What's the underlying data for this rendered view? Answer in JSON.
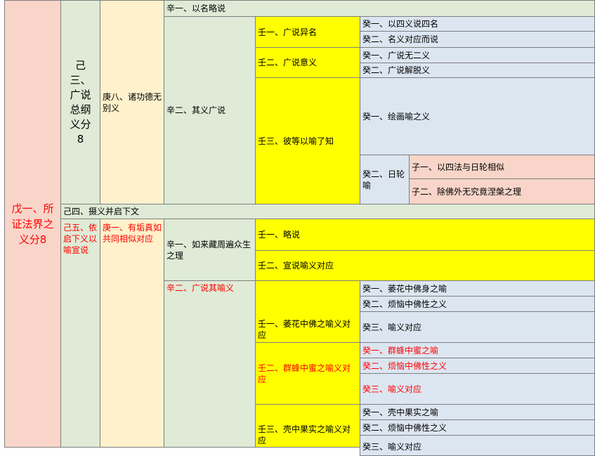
{
  "wu1": "戊一、所证法界之义分8",
  "ji3": "己三、广说总纲义分8",
  "geng8": "庚八、诸功德无别义",
  "xin1": "辛一、以名略说",
  "xin2_top": "辛二、其义广说",
  "ren1": "壬一、广说异名",
  "ren2": "壬二、广说意义",
  "ren3": "壬三、彼等以喻了知",
  "gui_r1_1": "癸一、以四义说四名",
  "gui_r1_2": "癸二、名义对应而说",
  "gui_r2_1": "癸一、广说无二义",
  "gui_r2_2": "癸二、广说解脱义",
  "gui_r3_1": "癸一、绘画喻之义",
  "gui_r3_2": "癸二、日轮喻",
  "zi1": "子一、以四法与日轮相似",
  "zi2": "子二、除佛外无究竟涅槃之理",
  "ji4": "己四、摄义并启下文",
  "ji5": "己五、依启下义以喻宣说",
  "geng1": "庚一、有垢真如共同相似对应",
  "xin1b": "辛一、如来藏周遍众生之理",
  "ren1b": "壬一、略说",
  "ren2b": "壬二、宣说喻义对应",
  "xin2b": "辛二、广说其喻义",
  "ren_lotus": "壬一、萎花中佛之喻义对应",
  "gui_lotus_1": "癸一、萎花中佛身之喻",
  "gui_lotus_2": "癸二、烦恼中佛性之义",
  "gui_lotus_3": "癸三、喻义对应",
  "ren_bee": "壬二、群蜂中蜜之喻义对应",
  "gui_bee_1": "癸一、群蜂中蜜之喻",
  "gui_bee_2": "癸二、烦恼中佛性之义",
  "gui_bee_3": "癸三、喻义对应",
  "ren_husk": "壬三、壳中果实之喻义对应",
  "gui_husk_1": "癸一、壳中果实之喻",
  "gui_husk_2": "癸二、烦恼中佛性之义",
  "gui_husk_3": "癸三、喻义对应"
}
